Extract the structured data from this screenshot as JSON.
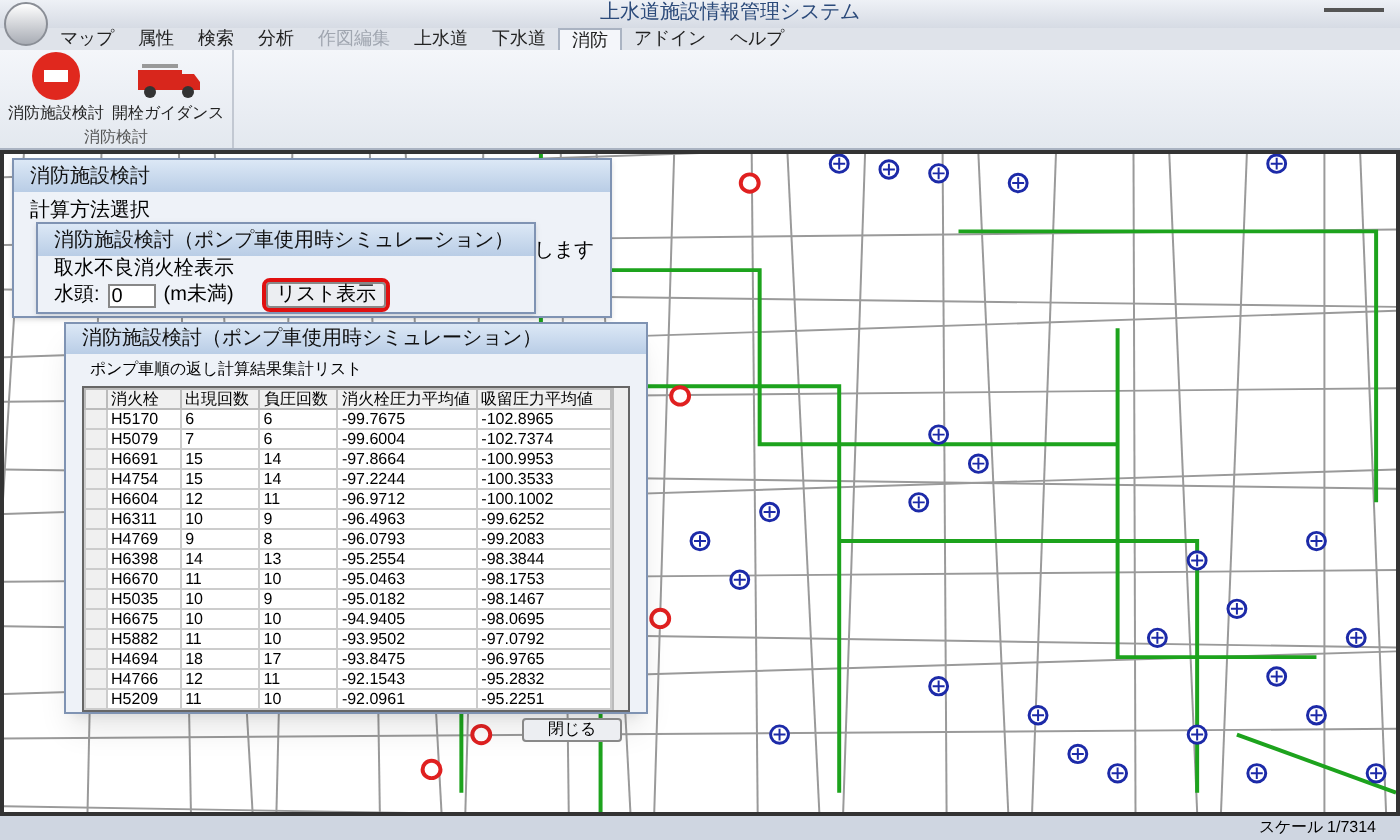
{
  "window": {
    "title": "上水道施設情報管理システム"
  },
  "menu_tabs": [
    {
      "label": "マップ",
      "selected": false,
      "disabled": false
    },
    {
      "label": "属性",
      "selected": false,
      "disabled": false
    },
    {
      "label": "検索",
      "selected": false,
      "disabled": false
    },
    {
      "label": "分析",
      "selected": false,
      "disabled": false
    },
    {
      "label": "作図編集",
      "selected": false,
      "disabled": true
    },
    {
      "label": "上水道",
      "selected": false,
      "disabled": false
    },
    {
      "label": "下水道",
      "selected": false,
      "disabled": false
    },
    {
      "label": "消防",
      "selected": true,
      "disabled": false
    },
    {
      "label": "アドイン",
      "selected": false,
      "disabled": false
    },
    {
      "label": "ヘルプ",
      "selected": false,
      "disabled": false
    }
  ],
  "ribbon": {
    "group": "消防検討",
    "buttons": [
      {
        "label": "消防施設検討",
        "kind": "hydrant"
      },
      {
        "label": "開栓ガイダンス",
        "kind": "truck"
      }
    ]
  },
  "dialog_main": {
    "title": "消防施設検討",
    "section": "計算方法選択",
    "text_fragment": "します"
  },
  "dialog_pump": {
    "title": "消防施設検討（ポンプ車使用時シミュレーション）",
    "section": "取水不良消火栓表示",
    "head_label": "水頭:",
    "head_value": "0",
    "unit": "(m未満)",
    "list_button": "リスト表示"
  },
  "dialog_list": {
    "title": "消防施設検討（ポンプ車使用時シミュレーション）",
    "caption": "ポンプ車順の返し計算結果集計リスト",
    "table": {
      "columns": [
        "消火栓",
        "出現回数",
        "負圧回数",
        "消火栓圧力平均値",
        "吸留圧力平均値"
      ],
      "rows": [
        [
          "H5170",
          "6",
          "6",
          "-99.7675",
          "-102.8965"
        ],
        [
          "H5079",
          "7",
          "6",
          "-99.6004",
          "-102.7374"
        ],
        [
          "H6691",
          "15",
          "14",
          "-97.8664",
          "-100.9953"
        ],
        [
          "H4754",
          "15",
          "14",
          "-97.2244",
          "-100.3533"
        ],
        [
          "H6604",
          "12",
          "11",
          "-96.9712",
          "-100.1002"
        ],
        [
          "H6311",
          "10",
          "9",
          "-96.4963",
          "-99.6252"
        ],
        [
          "H4769",
          "9",
          "8",
          "-96.0793",
          "-99.2083"
        ],
        [
          "H6398",
          "14",
          "13",
          "-95.2554",
          "-98.3844"
        ],
        [
          "H6670",
          "11",
          "10",
          "-95.0463",
          "-98.1753"
        ],
        [
          "H5035",
          "10",
          "9",
          "-95.0182",
          "-98.1467"
        ],
        [
          "H6675",
          "10",
          "10",
          "-94.9405",
          "-98.0695"
        ],
        [
          "H5882",
          "11",
          "10",
          "-93.9502",
          "-97.0792"
        ],
        [
          "H4694",
          "18",
          "17",
          "-93.8475",
          "-96.9765"
        ],
        [
          "H4766",
          "12",
          "11",
          "-92.1543",
          "-95.2832"
        ],
        [
          "H5209",
          "11",
          "10",
          "-92.0961",
          "-95.2251"
        ]
      ]
    },
    "close_button": "閉じる"
  },
  "status_bar": {
    "scale": "スケール 1/7314"
  }
}
